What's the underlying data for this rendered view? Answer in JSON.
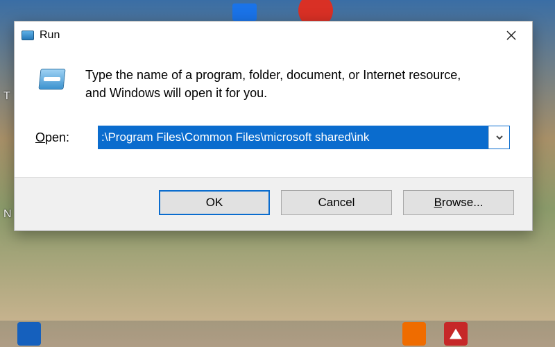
{
  "dialog": {
    "title": "Run",
    "description": "Type the name of a program, folder, document, or Internet resource, and Windows will open it for you.",
    "open_label_pre": "O",
    "open_label_rest": "pen:",
    "input_value": ":\\Program Files\\Common Files\\microsoft shared\\ink",
    "buttons": {
      "ok": "OK",
      "cancel": "Cancel",
      "browse_pre": "B",
      "browse_rest": "rowse..."
    }
  }
}
